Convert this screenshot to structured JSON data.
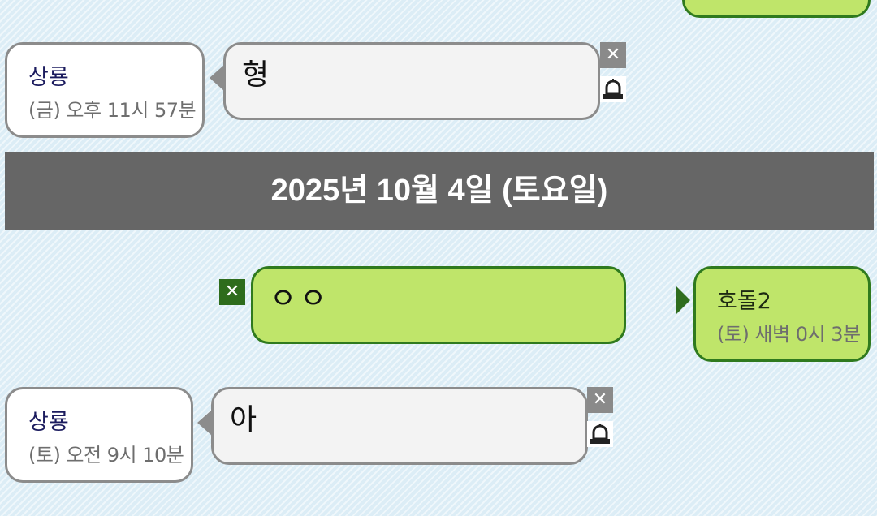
{
  "messages": [
    {
      "sender": "상룡",
      "timestamp": "(금) 오후 11시 57분",
      "text": "형"
    },
    {
      "sender": "호돌2",
      "timestamp": "(토) 새벽 0시 3분",
      "text": "ㅇㅇ"
    },
    {
      "sender": "상룡",
      "timestamp": "(토) 오전 9시 10분",
      "text": "아"
    }
  ],
  "date_separator": "2025년 10월 4일 (토요일)",
  "icons": {
    "delete": "close-icon",
    "report": "siren-icon"
  },
  "colors": {
    "own_bubble": "#bfe56a",
    "own_border": "#2f7a1e",
    "other_bubble": "#f3f3f3",
    "other_border": "#8c8c8c",
    "date_bar": "#666666",
    "background": "#dcedf6"
  }
}
